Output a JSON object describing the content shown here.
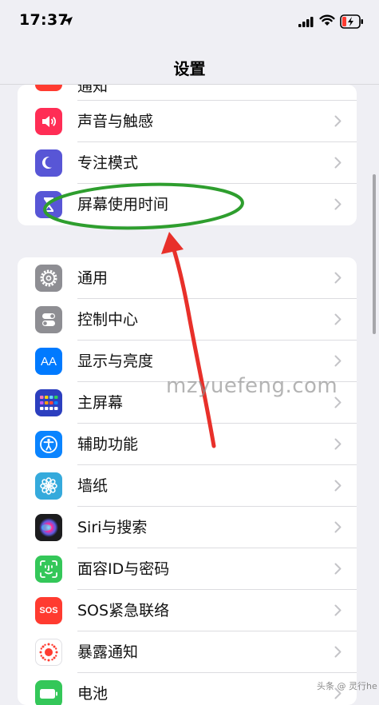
{
  "status_bar": {
    "time": "17:37"
  },
  "nav": {
    "title": "设置"
  },
  "group1": {
    "items": [
      {
        "label": "通知",
        "icon": "notifications-icon",
        "color": "#ff3b30"
      },
      {
        "label": "声音与触感",
        "icon": "sound-icon",
        "color": "#ff2d55"
      },
      {
        "label": "专注模式",
        "icon": "moon-icon",
        "color": "#5856d6"
      },
      {
        "label": "屏幕使用时间",
        "icon": "hourglass-icon",
        "color": "#5856d6"
      }
    ]
  },
  "group2": {
    "items": [
      {
        "label": "通用",
        "icon": "gear-icon",
        "color": "#8e8e93"
      },
      {
        "label": "控制中心",
        "icon": "toggles-icon",
        "color": "#8e8e93"
      },
      {
        "label": "显示与亮度",
        "icon": "text-size-icon",
        "color": "#007aff"
      },
      {
        "label": "主屏幕",
        "icon": "home-screen-icon",
        "color": "#2c3fbf"
      },
      {
        "label": "辅助功能",
        "icon": "accessibility-icon",
        "color": "#0a84ff"
      },
      {
        "label": "墙纸",
        "icon": "flower-icon",
        "color": "#35aadc"
      },
      {
        "label": "Siri与搜索",
        "icon": "siri-icon",
        "color": "#1c1c1e"
      },
      {
        "label": "面容ID与密码",
        "icon": "face-id-icon",
        "color": "#34c759"
      },
      {
        "label": "SOS紧急联络",
        "icon": "sos-icon",
        "color": "#ff3b30"
      },
      {
        "label": "暴露通知",
        "icon": "exposure-icon",
        "color": "#ffffff"
      },
      {
        "label": "电池",
        "icon": "battery-icon",
        "color": "#34c759"
      }
    ]
  },
  "sos_text": "SOS",
  "text_size_glyph": "AA",
  "watermark": "mzyuefeng.com",
  "corner_logo": "头条 @ 灵行he",
  "annotation": {
    "color": "#e8302a",
    "ellipse_color": "#2e9e2e"
  }
}
